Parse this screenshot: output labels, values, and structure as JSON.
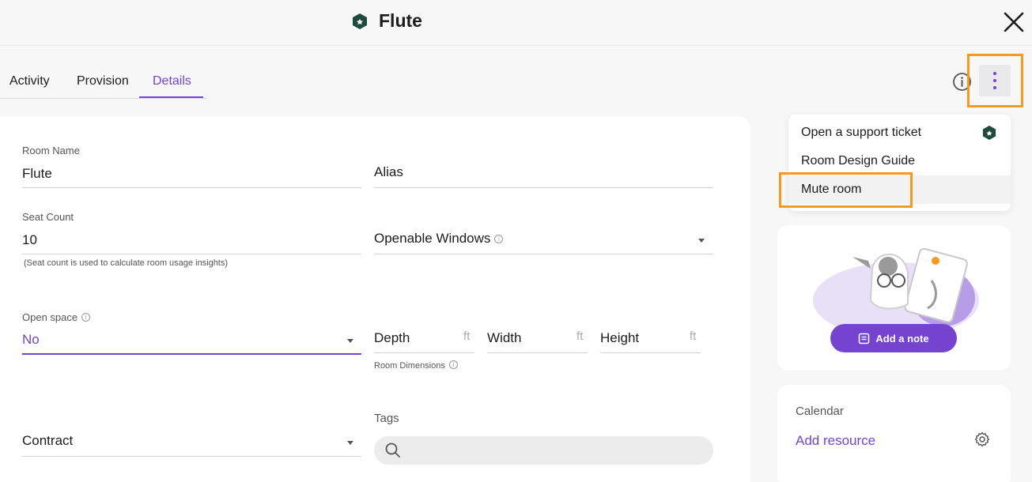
{
  "header": {
    "title": "Flute",
    "logo_icon": "hex-badge-icon",
    "close_icon": "close-icon"
  },
  "tabs": [
    {
      "label": "Activity",
      "active": false
    },
    {
      "label": "Provision",
      "active": false
    },
    {
      "label": "Details",
      "active": true
    }
  ],
  "toolbar": {
    "info_icon": "info-icon",
    "more_icon": "kebab-menu-icon"
  },
  "form": {
    "room_name": {
      "label": "Room Name",
      "value": "Flute"
    },
    "alias": {
      "placeholder": "Alias"
    },
    "seat_count": {
      "label": "Seat Count",
      "value": "10",
      "hint": "(Seat count is used to calculate room usage insights)"
    },
    "openable_windows": {
      "placeholder": "Openable Windows"
    },
    "open_space": {
      "label": "Open space",
      "value": "No"
    },
    "depth": {
      "placeholder": "Depth",
      "unit": "ft"
    },
    "width": {
      "placeholder": "Width",
      "unit": "ft"
    },
    "height": {
      "placeholder": "Height",
      "unit": "ft"
    },
    "room_dimensions_hint": "Room Dimensions",
    "contract": {
      "placeholder": "Contract"
    },
    "tags": {
      "label": "Tags"
    }
  },
  "menu": {
    "items": [
      {
        "label": "Open a support ticket"
      },
      {
        "label": "Room Design Guide"
      },
      {
        "label": "Mute room"
      }
    ]
  },
  "note_card": {
    "button_label": "Add a note"
  },
  "calendar": {
    "title": "Calendar",
    "link": "Add resource"
  },
  "colors": {
    "accent": "#7443d0",
    "highlight": "#f59a1a",
    "logo": "#1f4a3e"
  }
}
